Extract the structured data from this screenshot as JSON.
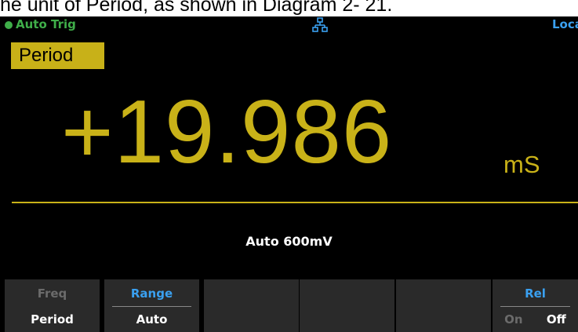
{
  "caption": "he unit of Period, as shown in Diagram 2- 21.",
  "status": {
    "trigger": "Auto Trig",
    "remote": "Loca"
  },
  "function_label": "Period",
  "measurement": {
    "value": "+19.986",
    "unit": "mS"
  },
  "range_info": "Auto 600mV",
  "softkeys": [
    {
      "top": "Freq",
      "bottom": "Period"
    },
    {
      "top": "Range",
      "bottom": "Auto"
    },
    {
      "top": "",
      "bottom": ""
    },
    {
      "top": "",
      "bottom": ""
    },
    {
      "top": "",
      "bottom": ""
    },
    {
      "top": "Rel",
      "options": [
        "On",
        "Off"
      ]
    }
  ],
  "colors": {
    "reading": "#c9b218",
    "highlight": "#c8b118",
    "status_green": "#3fae49",
    "accent_blue": "#3aa0f0"
  },
  "icons": {
    "network": "network-icon"
  }
}
